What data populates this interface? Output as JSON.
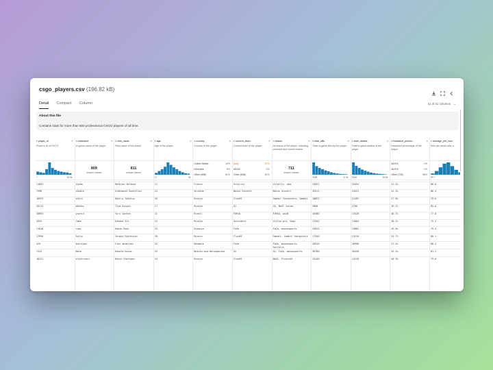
{
  "header": {
    "title": "csgo_players.csv",
    "size": "(196.82 kB)"
  },
  "tabs": [
    "Detail",
    "Compact",
    "Column"
  ],
  "columns_info": "41 of 41 columns",
  "about": {
    "title": "About this file",
    "text": "Contains stats for more than 800 professional CSGO players of all time."
  },
  "accent": "#1a7fb5",
  "columns": [
    {
      "name": "player_id",
      "type": "#",
      "desc": "Player's ID on HLTV",
      "summary": {
        "kind": "hist",
        "bars": [
          0.25,
          0.2,
          0.15,
          0.45,
          1.0,
          0.55,
          0.4,
          0.3,
          0.25,
          0.2,
          0.18,
          0.12
        ],
        "min": "7",
        "max": "20.9k"
      }
    },
    {
      "name": "nickname",
      "type": "A",
      "desc": "In-game name of the player",
      "summary": {
        "kind": "unique",
        "count": "809",
        "label": "unique values"
      }
    },
    {
      "name": "real_name",
      "type": "A",
      "desc": "Real name of the player",
      "summary": {
        "kind": "unique",
        "count": "811",
        "label": "unique values"
      }
    },
    {
      "name": "age",
      "type": "#",
      "desc": "Age of the player",
      "summary": {
        "kind": "hist",
        "bars": [
          0.15,
          0.3,
          0.45,
          0.65,
          1.0,
          0.8,
          0.6,
          0.45,
          0.3,
          0.2,
          0.12,
          0.08
        ],
        "min": "17",
        "max": "38"
      }
    },
    {
      "name": "country",
      "type": "A",
      "desc": "Country of the player",
      "summary": {
        "kind": "cats",
        "items": [
          {
            "label": "United States",
            "pct": "10%"
          },
          {
            "label": "Denmark",
            "pct": "8%"
          },
          {
            "label": "Other (658)",
            "pct": "81%"
          }
        ],
        "hl": -1
      }
    },
    {
      "name": "current_team",
      "type": "A",
      "desc": "Current team of the player",
      "summary": {
        "kind": "cats",
        "items": [
          {
            "label": "[null]",
            "pct": "37%"
          },
          {
            "label": "MOUZ",
            "pct": "1%"
          },
          {
            "label": "Other (508)",
            "pct": "62%"
          }
        ],
        "hl": 0
      }
    },
    {
      "name": "teams",
      "type": "A",
      "desc": "All teams of the player, including previous and current teams",
      "summary": {
        "kind": "unique",
        "count": "711",
        "label": "unique values"
      }
    },
    {
      "name": "total_kills",
      "type": "#",
      "desc": "Total in-game kills by the player",
      "summary": {
        "kind": "hist",
        "bars": [
          1.0,
          0.7,
          0.55,
          0.45,
          0.35,
          0.28,
          0.2,
          0.14,
          0.1,
          0.07,
          0.05,
          0.04
        ],
        "min": "9538",
        "max": "47.0k"
      }
    },
    {
      "name": "total_deaths",
      "type": "#",
      "desc": "Total in-game deaths of the player",
      "summary": {
        "kind": "hist",
        "bars": [
          1.0,
          0.72,
          0.55,
          0.42,
          0.32,
          0.25,
          0.18,
          0.13,
          0.09,
          0.07,
          0.05,
          0.03
        ],
        "min": "8168",
        "max": "39.5k"
      }
    },
    {
      "name": "headshot_percen...",
      "type": "#",
      "desc": "Headshot percentage of the player",
      "summary": {
        "kind": "cats",
        "items": [
          {
            "label": "48.6%",
            "pct": "1%"
          },
          {
            "label": "48.9%",
            "pct": "1%"
          },
          {
            "label": "Other (792)",
            "pct": "98%"
          }
        ],
        "hl": -1
      }
    },
    {
      "name": "damage_per_roun",
      "type": "#",
      "desc": "Kills per death ratio o",
      "summary": {
        "kind": "hist",
        "bars": [
          0.1,
          0.3,
          0.6,
          0.9,
          1.0,
          0.7,
          0.4,
          0.2,
          0.1
        ],
        "min": "59.7",
        "max": ""
      }
    }
  ],
  "rows": [
    [
      "11893",
      "ZywOo",
      "Mathieu Herbaut",
      "21",
      "France",
      "Vitality",
      "Vitality, aAa",
      "23022",
      "16494",
      "41.3%",
      "86.8"
    ],
    [
      "7998",
      "s1mple",
      "Aleksandr Kostyliev",
      "24",
      "Ukraine",
      "Natus Vincere",
      "Natus Vincere",
      "33511",
      "24413",
      "41.3%",
      "86.4"
    ],
    [
      "18929",
      "sh1ro",
      "Dmitry Sokolov",
      "20",
      "Russia",
      "Cloud9",
      "Gambit Youngsters, Gambit",
      "10851",
      "12492",
      "57.8%",
      "78.6"
    ],
    [
      "20113",
      "m0nesy",
      "Ilya Osipov",
      "17",
      "Russia",
      "G2",
      "G2, NAVI Junior",
      "3800",
      "2760",
      "39.1%",
      "85.6"
    ],
    [
      "18053",
      "yuurih",
      "Yuri Santos",
      "22",
      "Brazil",
      "FURIA",
      "FURIA, paiN",
      "18480",
      "13520",
      "46.7%",
      "77.8"
    ],
    [
      "4954",
      "Jame",
      "Dzhami Ali",
      "24",
      "Russia",
      "Outsiders",
      "Virtus.pro, Vega",
      "17542",
      "13004",
      "38.2%",
      "75.2"
    ],
    [
      "11816",
      "ropz",
      "Robin Kool",
      "22",
      "Estonia",
      "FaZe",
      "FaZe, mousesports",
      "25812",
      "19862",
      "49.6%",
      "79.3"
    ],
    [
      "17956",
      "Ax1Le",
      "Sergey Rykhtorov",
      "20",
      "Russia",
      "Cloud9",
      "Gambit, Gambit Youngsters",
      "17340",
      "13210",
      "54.7%",
      "80.1"
    ],
    [
      "429",
      "karrigan",
      "Finn Andersen",
      "32",
      "Denmark",
      "FaZe",
      "FaZe, mousesports, Astralis",
      "28510",
      "26990",
      "37.4%",
      "68.4"
    ],
    [
      "7412",
      "NiKo",
      "Nikola Kovac",
      "25",
      "Bosnia and Herzegovina",
      "G2",
      "G2, FaZe, mousesports",
      "38780",
      "30450",
      "52.5%",
      "81.2"
    ],
    [
      "18221",
      "electronic",
      "Denis Sharipov",
      "24",
      "Russia",
      "Cloud9",
      "NAVI, Flipsid3",
      "29140",
      "24120",
      "48.3%",
      "79.0"
    ]
  ]
}
